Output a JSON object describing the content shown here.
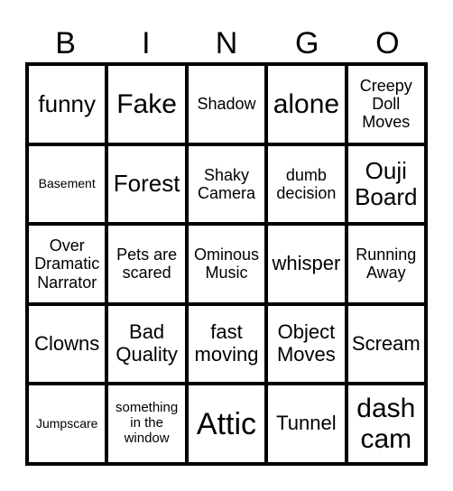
{
  "header": [
    "B",
    "I",
    "N",
    "G",
    "O"
  ],
  "cells": [
    {
      "text": "funny",
      "size": "xl"
    },
    {
      "text": "Fake",
      "size": "xxl"
    },
    {
      "text": "Shadow",
      "size": "m"
    },
    {
      "text": "alone",
      "size": "xxl"
    },
    {
      "text": "Creepy Doll Moves",
      "size": "m"
    },
    {
      "text": "Basement",
      "size": "s"
    },
    {
      "text": "Forest",
      "size": "xl"
    },
    {
      "text": "Shaky Camera",
      "size": "m"
    },
    {
      "text": "dumb decision",
      "size": "m"
    },
    {
      "text": "Ouji Board",
      "size": "xl"
    },
    {
      "text": "Over Dramatic Narrator",
      "size": "m"
    },
    {
      "text": "Pets are scared",
      "size": "m"
    },
    {
      "text": "Ominous Music",
      "size": "m"
    },
    {
      "text": "whisper",
      "size": "l"
    },
    {
      "text": "Running Away",
      "size": "m"
    },
    {
      "text": "Clowns",
      "size": "l"
    },
    {
      "text": "Bad Quality",
      "size": "l"
    },
    {
      "text": "fast moving",
      "size": "l"
    },
    {
      "text": "Object Moves",
      "size": "l"
    },
    {
      "text": "Scream",
      "size": "l"
    },
    {
      "text": "Jumpscare",
      "size": "s"
    },
    {
      "text": "something in the window",
      "size": "sm"
    },
    {
      "text": "Attic",
      "size": "xxxl"
    },
    {
      "text": "Tunnel",
      "size": "l"
    },
    {
      "text": "dash cam",
      "size": "xxl"
    }
  ]
}
